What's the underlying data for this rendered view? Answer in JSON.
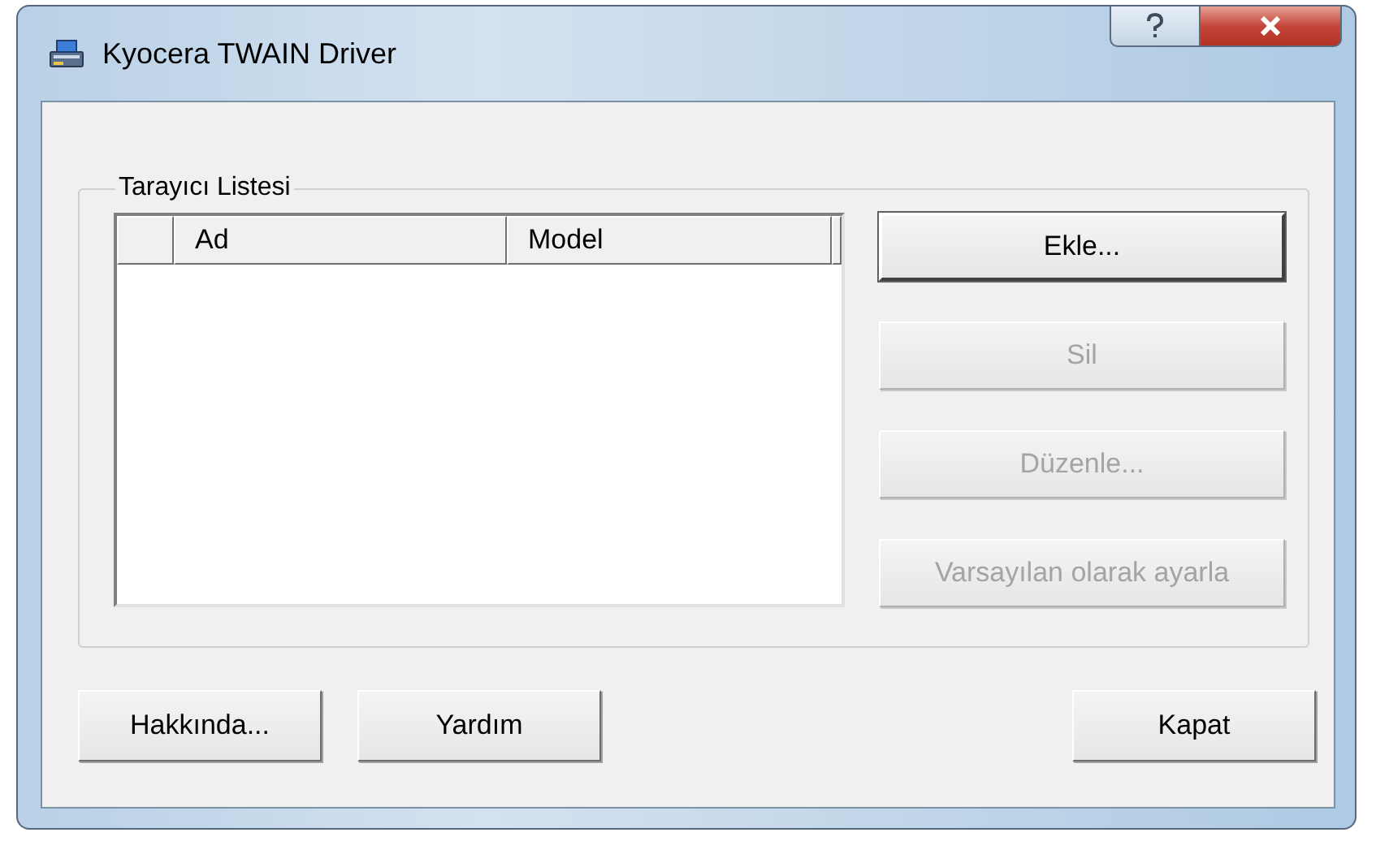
{
  "window": {
    "title": "Kyocera TWAIN Driver"
  },
  "scanner_list": {
    "label": "Tarayıcı Listesi",
    "columns": [
      "Ad",
      "Model"
    ]
  },
  "side_buttons": [
    {
      "label": "Ekle...",
      "disabled": false,
      "default": true
    },
    {
      "label": "Sil",
      "disabled": true,
      "default": false
    },
    {
      "label": "Düzenle...",
      "disabled": true,
      "default": false
    },
    {
      "label": "Varsayılan olarak ayarla",
      "disabled": true,
      "default": false
    }
  ],
  "footer_buttons": [
    {
      "label": "Hakkında..."
    },
    {
      "label": "Yardım"
    },
    {
      "label": "Kapat"
    }
  ]
}
